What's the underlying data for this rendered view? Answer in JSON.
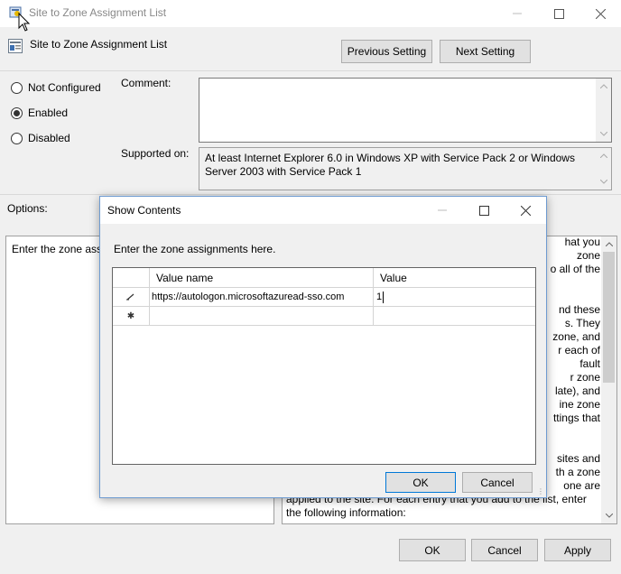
{
  "window": {
    "title": "Site to Zone Assignment List",
    "setting_name": "Site to Zone Assignment List",
    "prev_setting": "Previous Setting",
    "next_setting": "Next Setting"
  },
  "state": {
    "options": [
      "Not Configured",
      "Enabled",
      "Disabled"
    ],
    "selected": "Enabled"
  },
  "labels": {
    "comment": "Comment:",
    "supported_on": "Supported on:",
    "options": "Options:"
  },
  "supported_text": "At least Internet Explorer 6.0 in Windows XP with Service Pack 2 or Windows Server 2003 with Service Pack 1",
  "options_pane_text": "Enter the zone assi",
  "help_fragments": [
    "hat you",
    "zone",
    "o all of the",
    "nd these",
    "s. They",
    "zone, and",
    "r each of",
    "fault",
    "r zone",
    "late), and",
    "ine zone",
    "ttings that",
    "sites and",
    "th a zone",
    "one are",
    "applied to the site.  For each entry that you add to the list, enter",
    "the following information:"
  ],
  "footer": {
    "ok": "OK",
    "cancel": "Cancel",
    "apply": "Apply"
  },
  "dialog": {
    "title": "Show Contents",
    "instruction": "Enter the zone assignments here.",
    "columns": [
      "Value name",
      "Value"
    ],
    "rows": [
      {
        "marker": "pencil",
        "name": "https://autologon.microsoftazuread-sso.com",
        "value": "1"
      },
      {
        "marker": "asterisk",
        "name": "",
        "value": ""
      }
    ],
    "ok": "OK",
    "cancel": "Cancel"
  }
}
